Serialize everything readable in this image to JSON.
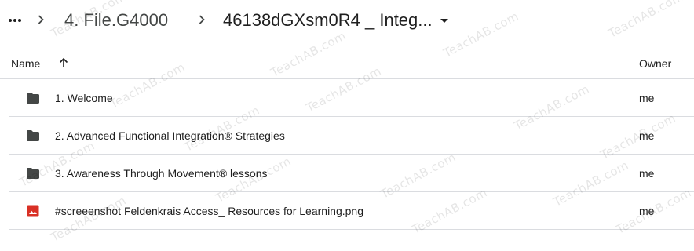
{
  "breadcrumb": {
    "more_icon": "more-horiz-icon",
    "separator_icon": "chevron-right-icon",
    "parent": "4. File.G4000",
    "current": "46138dGXsm0R4 _ Integ...",
    "current_menu_icon": "arrow-drop-down-icon"
  },
  "header": {
    "name_label": "Name",
    "sort_icon": "arrow-upward-icon",
    "owner_label": "Owner"
  },
  "files": [
    {
      "icon": "folder-icon",
      "name": "1. Welcome",
      "owner": "me"
    },
    {
      "icon": "folder-icon",
      "name": "2. Advanced Functional Integration® Strategies",
      "owner": "me"
    },
    {
      "icon": "folder-icon",
      "name": "3. Awareness Through Movement® lessons",
      "owner": "me"
    },
    {
      "icon": "image-file-icon",
      "name": "#screeenshot  Feldenkrais Access_ Resources for Learning.png",
      "owner": "me"
    }
  ],
  "watermark": {
    "text": "TeachAB.com"
  },
  "colors": {
    "folder": "#444746",
    "image_file": "#d93025",
    "divider": "#dadce0",
    "text": "#1f1f1f",
    "muted_text": "#444746"
  }
}
